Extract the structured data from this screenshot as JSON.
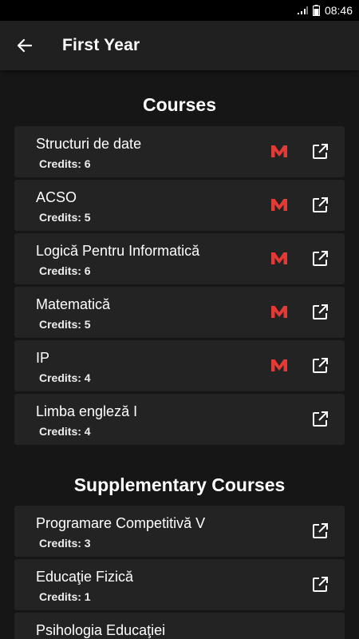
{
  "status_bar": {
    "time": "08:46"
  },
  "app_bar": {
    "title": "First Year",
    "back_icon": "arrow-back-icon"
  },
  "sections": {
    "courses": {
      "title": "Courses",
      "items": [
        {
          "name": "Structuri de date",
          "credits": "Credits: 6",
          "has_moodle": true
        },
        {
          "name": "ACSO",
          "credits": "Credits: 5",
          "has_moodle": true
        },
        {
          "name": "Logică Pentru Informatică",
          "credits": "Credits: 6",
          "has_moodle": true
        },
        {
          "name": "Matematică",
          "credits": "Credits: 5",
          "has_moodle": true
        },
        {
          "name": "IP",
          "credits": "Credits: 4",
          "has_moodle": true
        },
        {
          "name": "Limba engleză I",
          "credits": "Credits: 4",
          "has_moodle": false
        }
      ]
    },
    "supplementary": {
      "title": "Supplementary Courses",
      "items": [
        {
          "name": "Programare Competitivă V",
          "credits": "Credits: 3",
          "has_moodle": false
        },
        {
          "name": "Educaţie Fizică",
          "credits": "Credits: 1",
          "has_moodle": false
        },
        {
          "name": "Psihologia Educaţiei",
          "credits": "",
          "has_moodle": false
        }
      ]
    }
  },
  "colors": {
    "background": "#161616",
    "card": "#232323",
    "app_bar": "#202020",
    "moodle_accent": "#e53935"
  }
}
